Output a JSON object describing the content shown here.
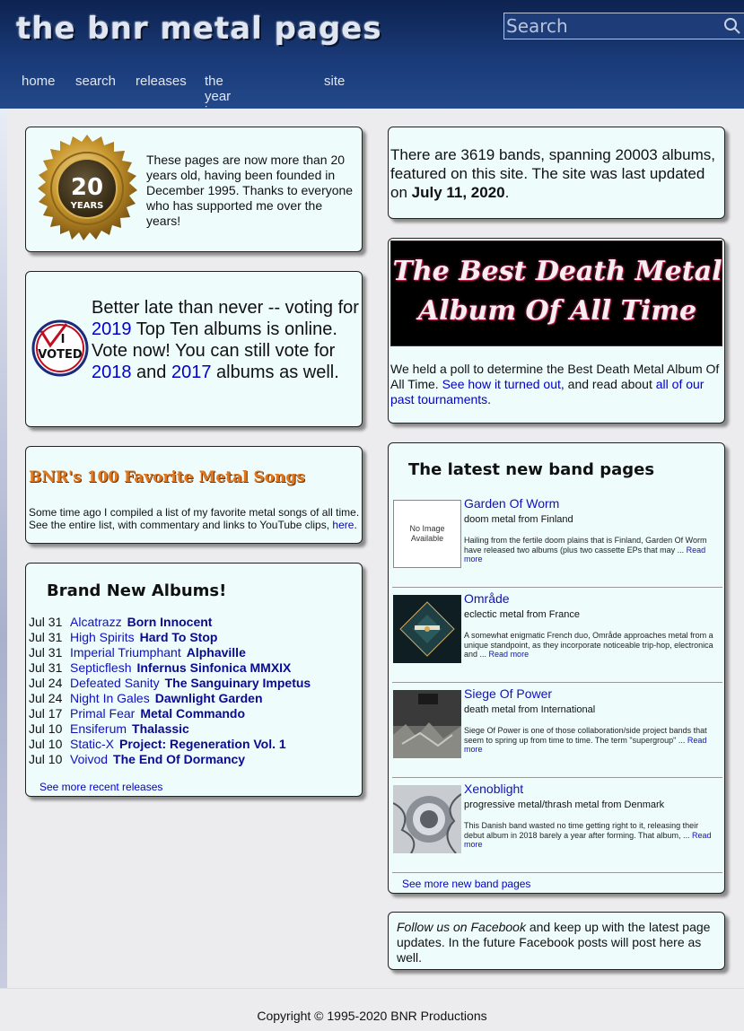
{
  "header": {
    "logo": "the bnr metal pages",
    "search_placeholder": "Search",
    "nav": [
      "home",
      "search",
      "releases",
      "the year in metal",
      "site"
    ]
  },
  "anniversary": {
    "seal_number": "20",
    "seal_word": "YEARS",
    "text": "These pages are now more than 20 years old, having been founded in December 1995. Thanks to everyone who has supported me over the years!"
  },
  "voting": {
    "badge_word_1": "I",
    "badge_word_2": "VOTED",
    "text_1": "Better late than never -- voting for ",
    "link_2019": "2019",
    "text_2": " Top Ten albums is online. Vote now! You can still vote for ",
    "link_2018": "2018",
    "text_3": " and ",
    "link_2017": "2017",
    "text_4": " albums as well."
  },
  "songs": {
    "title": "BNR's 100 Favorite Metal Songs",
    "text": "Some time ago I compiled a list of my favorite metal songs of all time. See the entire list, with commentary and links to YouTube clips, ",
    "link": "here",
    "end": "."
  },
  "albums": {
    "title": "Brand New Albums!",
    "items": [
      {
        "date": "Jul 31",
        "band": "Alcatrazz",
        "title": "Born Innocent"
      },
      {
        "date": "Jul 31",
        "band": "High Spirits",
        "title": "Hard To Stop"
      },
      {
        "date": "Jul 31",
        "band": "Imperial Triumphant",
        "title": "Alphaville"
      },
      {
        "date": "Jul 31",
        "band": "Septicflesh",
        "title": "Infernus Sinfonica MMXIX"
      },
      {
        "date": "Jul 24",
        "band": "Defeated Sanity",
        "title": "The Sanguinary Impetus"
      },
      {
        "date": "Jul 24",
        "band": "Night In Gales",
        "title": "Dawnlight Garden"
      },
      {
        "date": "Jul 17",
        "band": "Primal Fear",
        "title": "Metal Commando"
      },
      {
        "date": "Jul 10",
        "band": "Ensiferum",
        "title": "Thalassic"
      },
      {
        "date": "Jul 10",
        "band": "Static-X",
        "title": "Project: Regeneration Vol. 1"
      },
      {
        "date": "Jul 10",
        "band": "Voivod",
        "title": "The End Of Dormancy"
      }
    ],
    "more": "See more recent releases"
  },
  "stats": {
    "text_1": "There are 3619 bands, spanning 20003 albums, featured on this site. The site was last updated on ",
    "date": "July 11, 2020",
    "text_2": "."
  },
  "poll": {
    "banner_line_1": "The Best Death Metal",
    "banner_line_2": "Album Of All Time",
    "text_1": "We held a poll to determine the Best Death Metal Album Of All Time. ",
    "link_1": "See how it turned out",
    "text_2": ", and read about ",
    "link_2": "all of our past tournaments",
    "text_3": "."
  },
  "bands": {
    "title": "The latest new band pages",
    "no_image": "No Image Available",
    "read_more": "Read more",
    "items": [
      {
        "name": "Garden Of Worm",
        "genre": "doom metal from Finland",
        "desc": "Hailing from the fertile doom plains that is Finland, Garden Of Worm have released two albums (plus two cassette EPs that may ..."
      },
      {
        "name": "Område",
        "genre": "eclectic metal from France",
        "desc": "A somewhat enigmatic French duo, Område approaches metal from a unique standpoint, as they incorporate noticeable trip-hop, electronica and ..."
      },
      {
        "name": "Siege Of Power",
        "genre": "death metal from International",
        "desc": "Siege Of Power is one of those collaboration/side project bands that seem to spring up from time to time. The term \"supergroup\" ..."
      },
      {
        "name": "Xenoblight",
        "genre": "progressive metal/thrash metal from Denmark",
        "desc": "This Danish band wasted no time getting right to it, releasing their debut album in 2018 barely a year after forming. That album, ..."
      }
    ],
    "more": "See more new band pages"
  },
  "facebook": {
    "link": "Follow us on Facebook",
    "text": " and keep up with the latest page updates. In the future Facebook posts will post here as well."
  },
  "footer": {
    "copyright": "Copyright © 1995-2020 BNR Productions"
  }
}
